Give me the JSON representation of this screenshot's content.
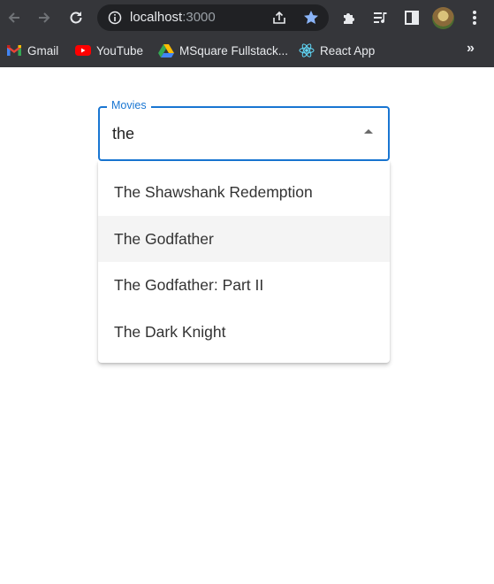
{
  "browser": {
    "url_host": "localhost",
    "url_port": ":3000",
    "bookmarks": [
      {
        "label": "Gmail",
        "icon": "gmail-icon"
      },
      {
        "label": "YouTube",
        "icon": "youtube-icon"
      },
      {
        "label": "MSquare Fullstack...",
        "icon": "google-drive-icon"
      },
      {
        "label": "React App",
        "icon": "react-icon"
      }
    ],
    "more_label": "»",
    "colors": {
      "frame": "#35363a",
      "omnibox": "#202124",
      "star": "#8ab4f8"
    }
  },
  "autocomplete": {
    "label": "Movies",
    "value": "the",
    "accent": "#1976d2",
    "options": [
      {
        "label": "The Shawshank Redemption",
        "highlighted": false
      },
      {
        "label": "The Godfather",
        "highlighted": true
      },
      {
        "label": "The Godfather: Part II",
        "highlighted": false
      },
      {
        "label": "The Dark Knight",
        "highlighted": false
      }
    ]
  }
}
